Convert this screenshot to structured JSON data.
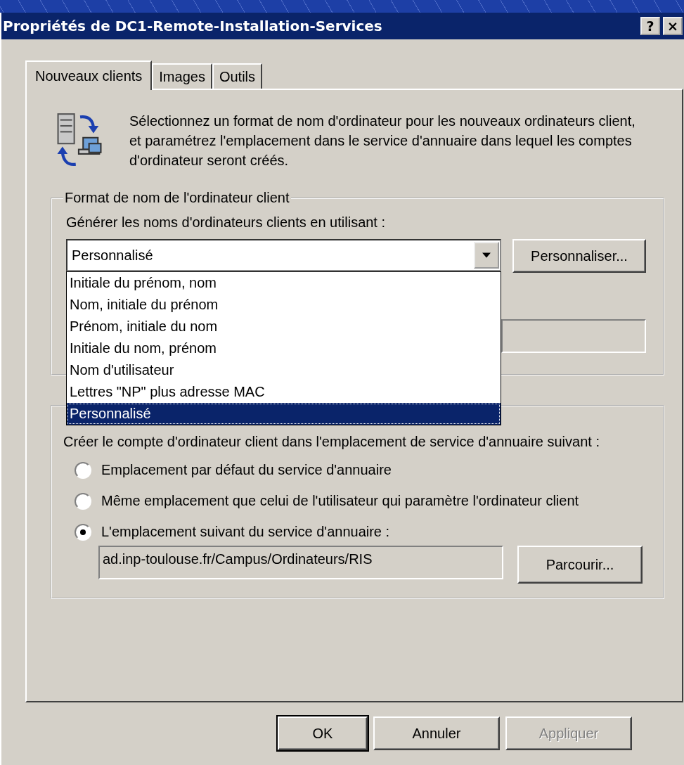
{
  "window": {
    "title": "Propriétés de DC1-Remote-Installation-Services",
    "title_buttons": [
      "?",
      "×"
    ]
  },
  "tabs": [
    {
      "label": "Nouveaux clients",
      "selected": true
    },
    {
      "label": "Images",
      "selected": false
    },
    {
      "label": "Outils",
      "selected": false
    }
  ],
  "description": "Sélectionnez un format de nom d'ordinateur pour les nouveaux ordinateurs client, et paramétrez l'emplacement dans le service d'annuaire dans lequel les comptes d'ordinateur seront créés.",
  "name_format": {
    "legend": "Format de nom de l'ordinateur client",
    "label": "Générer les noms d'ordinateurs clients en utilisant :",
    "combo": {
      "value": "Personnalisé",
      "expanded": true
    },
    "customize_button": "Personnaliser...",
    "options": [
      {
        "label": "Initiale du prénom, nom",
        "selected": false
      },
      {
        "label": "Nom, initiale du prénom",
        "selected": false
      },
      {
        "label": "Prénom, initiale du nom",
        "selected": false
      },
      {
        "label": "Initiale du nom, prénom",
        "selected": false
      },
      {
        "label": "Nom d'utilisateur",
        "selected": false
      },
      {
        "label": "Lettres \"NP\" plus adresse MAC",
        "selected": false
      },
      {
        "label": "Personnalisé",
        "selected": true
      }
    ]
  },
  "location": {
    "text": "Créer le compte d'ordinateur client dans l'emplacement de service d'annuaire suivant :",
    "options": [
      {
        "label": "Emplacement par défaut du service d'annuaire",
        "selected": false
      },
      {
        "label": "Même emplacement que celui de l'utilisateur qui paramètre l'ordinateur client",
        "selected": false
      },
      {
        "label": "L'emplacement suivant du service d'annuaire :",
        "selected": true
      }
    ],
    "path_field": {
      "value": "ad.inp-toulouse.fr/Campus/Ordinateurs/RIS"
    },
    "browse_button": "Parcourir..."
  },
  "buttons": [
    {
      "label": "OK",
      "disabled": false,
      "default": true
    },
    {
      "label": "Annuler",
      "disabled": false,
      "default": false
    },
    {
      "label": "Appliquer",
      "disabled": true,
      "default": false
    }
  ]
}
